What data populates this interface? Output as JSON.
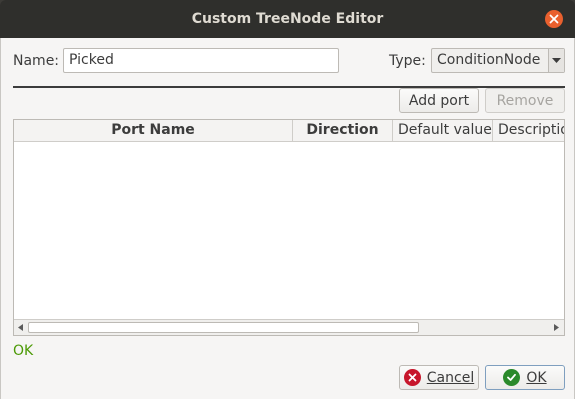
{
  "window": {
    "title": "Custom TreeNode Editor",
    "close_icon": "close-icon"
  },
  "form": {
    "name_label": "Name:",
    "name_value": "Picked",
    "type_label": "Type:",
    "type_value": "ConditionNode"
  },
  "toolbar": {
    "add_port_label": "Add port",
    "remove_label": "Remove"
  },
  "table": {
    "columns": [
      "Port Name",
      "Direction",
      "Default value",
      "Description"
    ],
    "rows": []
  },
  "status": {
    "text": "OK",
    "color": "#4c9a06"
  },
  "footer": {
    "cancel_label": "Cancel",
    "ok_label": "OK"
  },
  "colors": {
    "titlebar": "#2f2f2c",
    "close_button": "#e9602e",
    "cancel_icon": "#c7162b",
    "ok_icon": "#2b8a2b"
  }
}
